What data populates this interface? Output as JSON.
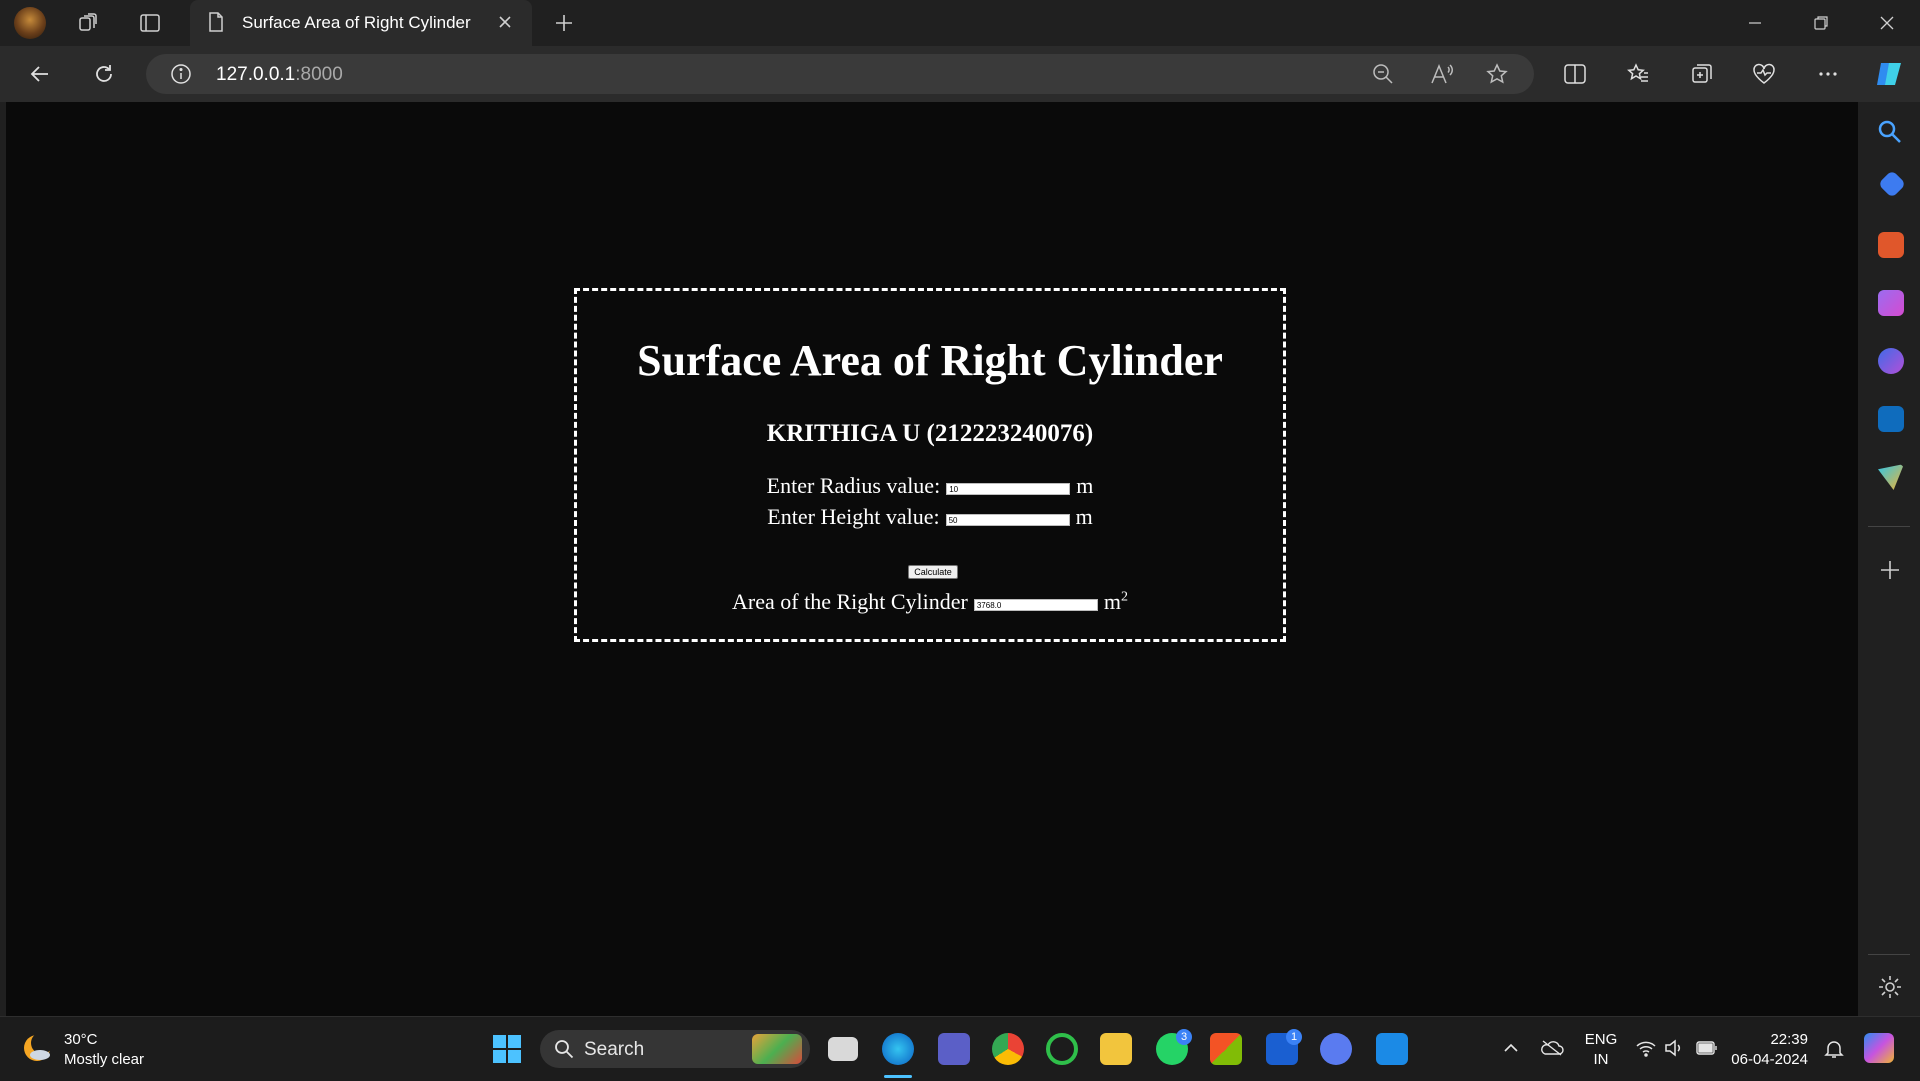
{
  "browser": {
    "tab_title": "Surface Area of Right Cylinder",
    "url_host": "127.0.0.1",
    "url_port": ":8000"
  },
  "page": {
    "title": "Surface Area of Right Cylinder",
    "subtitle": "KRITHIGA U (212223240076)",
    "radius_label": "Enter Radius value:",
    "radius_value": "10",
    "height_label": "Enter Height value:",
    "height_value": "50",
    "unit": "m",
    "calculate_label": "Calculate",
    "area_label": "Area of the Right Cylinder",
    "area_value": "3768.0",
    "area_unit": "m",
    "area_unit_exp": "2"
  },
  "taskbar": {
    "weather_temp": "30°C",
    "weather_desc": "Mostly clear",
    "search_label": "Search",
    "teams_badge": "3",
    "app_badge": "1",
    "lang_top": "ENG",
    "lang_bottom": "IN",
    "time": "22:39",
    "date": "06-04-2024"
  },
  "colors": {
    "page_bg": "#0a0a0a",
    "chrome_bg": "#202020",
    "accent": "#3b82f6"
  }
}
